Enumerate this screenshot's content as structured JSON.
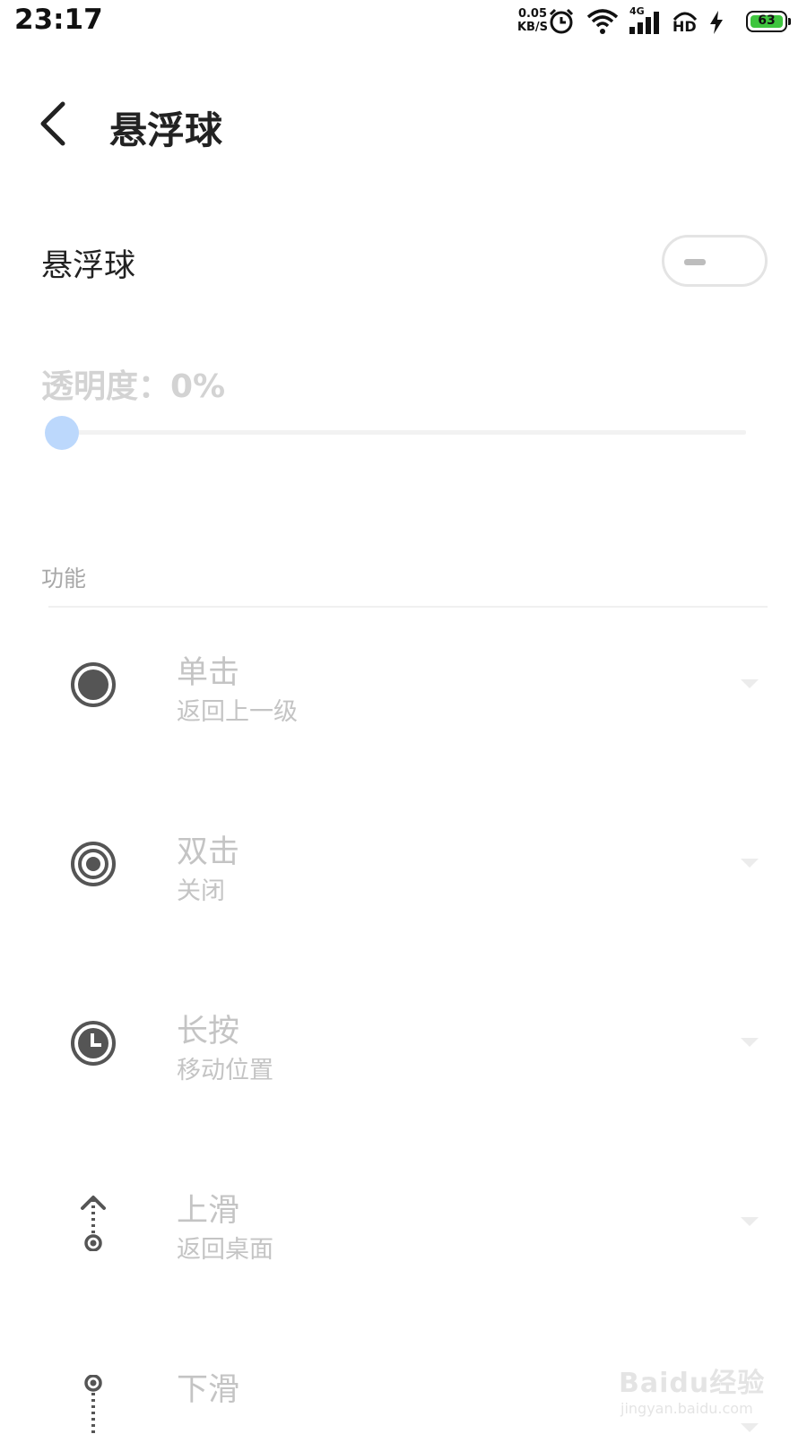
{
  "status_bar": {
    "time": "23:17",
    "net_speed_value": "0.05",
    "net_speed_unit": "KB/S",
    "network_type": "4G",
    "hd_label": "HD",
    "battery_level": "63",
    "icons": [
      "alarm-icon",
      "wifi-icon",
      "signal-icon",
      "hd-call-icon",
      "charging-icon",
      "battery-icon"
    ]
  },
  "header": {
    "title": "悬浮球"
  },
  "toggle_row": {
    "label": "悬浮球",
    "enabled": false
  },
  "opacity": {
    "label": "透明度：0%",
    "value_percent": 0
  },
  "section": {
    "title": "功能"
  },
  "functions": [
    {
      "icon": "single-tap-icon",
      "title": "单击",
      "subtitle": "返回上一级"
    },
    {
      "icon": "double-tap-icon",
      "title": "双击",
      "subtitle": "关闭"
    },
    {
      "icon": "long-press-icon",
      "title": "长按",
      "subtitle": "移动位置"
    },
    {
      "icon": "swipe-up-icon",
      "title": "上滑",
      "subtitle": "返回桌面"
    },
    {
      "icon": "swipe-down-icon",
      "title": "下滑",
      "subtitle": ""
    }
  ],
  "watermark": {
    "brand": "Baidu经验",
    "url": "jingyan.baidu.com"
  },
  "colors": {
    "accent_disabled": "#bcd8fc",
    "text_primary": "#222222",
    "text_disabled": "#c4c4c4",
    "battery_fill": "#3ec53e"
  }
}
